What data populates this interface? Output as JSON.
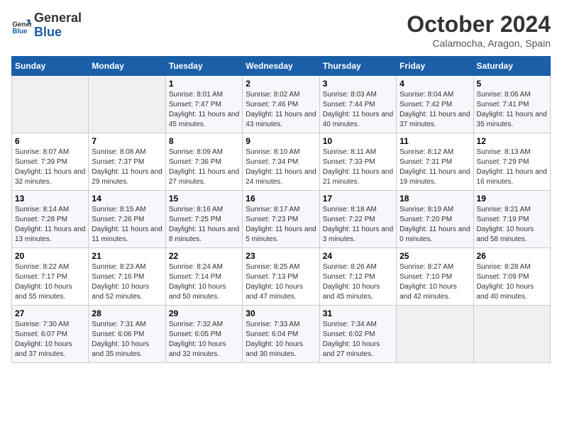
{
  "logo": {
    "line1": "General",
    "line2": "Blue"
  },
  "title": "October 2024",
  "subtitle": "Calamocha, Aragon, Spain",
  "days_header": [
    "Sunday",
    "Monday",
    "Tuesday",
    "Wednesday",
    "Thursday",
    "Friday",
    "Saturday"
  ],
  "weeks": [
    [
      {
        "day": "",
        "info": ""
      },
      {
        "day": "",
        "info": ""
      },
      {
        "day": "1",
        "info": "Sunrise: 8:01 AM\nSunset: 7:47 PM\nDaylight: 11 hours and 45 minutes."
      },
      {
        "day": "2",
        "info": "Sunrise: 8:02 AM\nSunset: 7:46 PM\nDaylight: 11 hours and 43 minutes."
      },
      {
        "day": "3",
        "info": "Sunrise: 8:03 AM\nSunset: 7:44 PM\nDaylight: 11 hours and 40 minutes."
      },
      {
        "day": "4",
        "info": "Sunrise: 8:04 AM\nSunset: 7:42 PM\nDaylight: 11 hours and 37 minutes."
      },
      {
        "day": "5",
        "info": "Sunrise: 8:06 AM\nSunset: 7:41 PM\nDaylight: 11 hours and 35 minutes."
      }
    ],
    [
      {
        "day": "6",
        "info": "Sunrise: 8:07 AM\nSunset: 7:39 PM\nDaylight: 11 hours and 32 minutes."
      },
      {
        "day": "7",
        "info": "Sunrise: 8:08 AM\nSunset: 7:37 PM\nDaylight: 11 hours and 29 minutes."
      },
      {
        "day": "8",
        "info": "Sunrise: 8:09 AM\nSunset: 7:36 PM\nDaylight: 11 hours and 27 minutes."
      },
      {
        "day": "9",
        "info": "Sunrise: 8:10 AM\nSunset: 7:34 PM\nDaylight: 11 hours and 24 minutes."
      },
      {
        "day": "10",
        "info": "Sunrise: 8:11 AM\nSunset: 7:33 PM\nDaylight: 11 hours and 21 minutes."
      },
      {
        "day": "11",
        "info": "Sunrise: 8:12 AM\nSunset: 7:31 PM\nDaylight: 11 hours and 19 minutes."
      },
      {
        "day": "12",
        "info": "Sunrise: 8:13 AM\nSunset: 7:29 PM\nDaylight: 11 hours and 16 minutes."
      }
    ],
    [
      {
        "day": "13",
        "info": "Sunrise: 8:14 AM\nSunset: 7:28 PM\nDaylight: 11 hours and 13 minutes."
      },
      {
        "day": "14",
        "info": "Sunrise: 8:15 AM\nSunset: 7:26 PM\nDaylight: 11 hours and 11 minutes."
      },
      {
        "day": "15",
        "info": "Sunrise: 8:16 AM\nSunset: 7:25 PM\nDaylight: 11 hours and 8 minutes."
      },
      {
        "day": "16",
        "info": "Sunrise: 8:17 AM\nSunset: 7:23 PM\nDaylight: 11 hours and 5 minutes."
      },
      {
        "day": "17",
        "info": "Sunrise: 8:18 AM\nSunset: 7:22 PM\nDaylight: 11 hours and 3 minutes."
      },
      {
        "day": "18",
        "info": "Sunrise: 8:19 AM\nSunset: 7:20 PM\nDaylight: 11 hours and 0 minutes."
      },
      {
        "day": "19",
        "info": "Sunrise: 8:21 AM\nSunset: 7:19 PM\nDaylight: 10 hours and 58 minutes."
      }
    ],
    [
      {
        "day": "20",
        "info": "Sunrise: 8:22 AM\nSunset: 7:17 PM\nDaylight: 10 hours and 55 minutes."
      },
      {
        "day": "21",
        "info": "Sunrise: 8:23 AM\nSunset: 7:16 PM\nDaylight: 10 hours and 52 minutes."
      },
      {
        "day": "22",
        "info": "Sunrise: 8:24 AM\nSunset: 7:14 PM\nDaylight: 10 hours and 50 minutes."
      },
      {
        "day": "23",
        "info": "Sunrise: 8:25 AM\nSunset: 7:13 PM\nDaylight: 10 hours and 47 minutes."
      },
      {
        "day": "24",
        "info": "Sunrise: 8:26 AM\nSunset: 7:12 PM\nDaylight: 10 hours and 45 minutes."
      },
      {
        "day": "25",
        "info": "Sunrise: 8:27 AM\nSunset: 7:10 PM\nDaylight: 10 hours and 42 minutes."
      },
      {
        "day": "26",
        "info": "Sunrise: 8:28 AM\nSunset: 7:09 PM\nDaylight: 10 hours and 40 minutes."
      }
    ],
    [
      {
        "day": "27",
        "info": "Sunrise: 7:30 AM\nSunset: 6:07 PM\nDaylight: 10 hours and 37 minutes."
      },
      {
        "day": "28",
        "info": "Sunrise: 7:31 AM\nSunset: 6:06 PM\nDaylight: 10 hours and 35 minutes."
      },
      {
        "day": "29",
        "info": "Sunrise: 7:32 AM\nSunset: 6:05 PM\nDaylight: 10 hours and 32 minutes."
      },
      {
        "day": "30",
        "info": "Sunrise: 7:33 AM\nSunset: 6:04 PM\nDaylight: 10 hours and 30 minutes."
      },
      {
        "day": "31",
        "info": "Sunrise: 7:34 AM\nSunset: 6:02 PM\nDaylight: 10 hours and 27 minutes."
      },
      {
        "day": "",
        "info": ""
      },
      {
        "day": "",
        "info": ""
      }
    ]
  ]
}
